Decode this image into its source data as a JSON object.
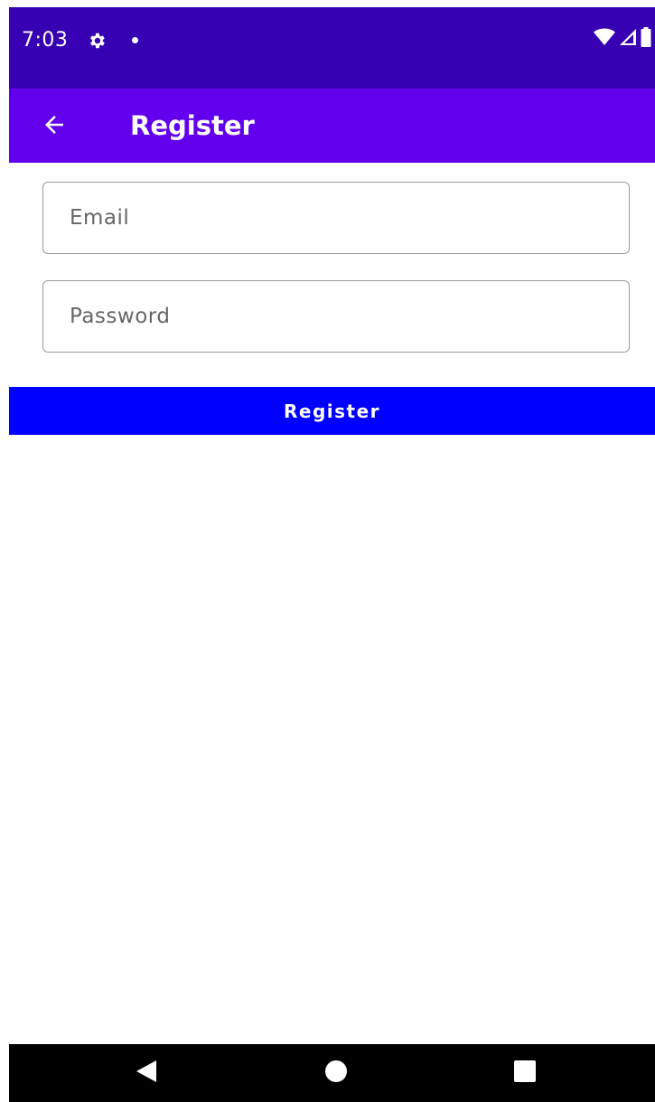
{
  "status_bar": {
    "time": "7:03",
    "icons": [
      "gear-icon",
      "notification-dot-icon",
      "wifi-icon",
      "cellular-signal-icon",
      "battery-icon"
    ]
  },
  "app_bar": {
    "title": "Register",
    "back_icon": "arrow-back-icon"
  },
  "form": {
    "email": {
      "placeholder": "Email",
      "value": ""
    },
    "password": {
      "placeholder": "Password",
      "value": ""
    },
    "submit_label": "Register"
  },
  "nav_bar": {
    "icons": [
      "nav-back-icon",
      "nav-home-icon",
      "nav-recents-icon"
    ]
  },
  "colors": {
    "status_bar": "#3700B3",
    "app_bar": "#6200EE",
    "button": "#0000FF",
    "nav_bar": "#000000"
  }
}
